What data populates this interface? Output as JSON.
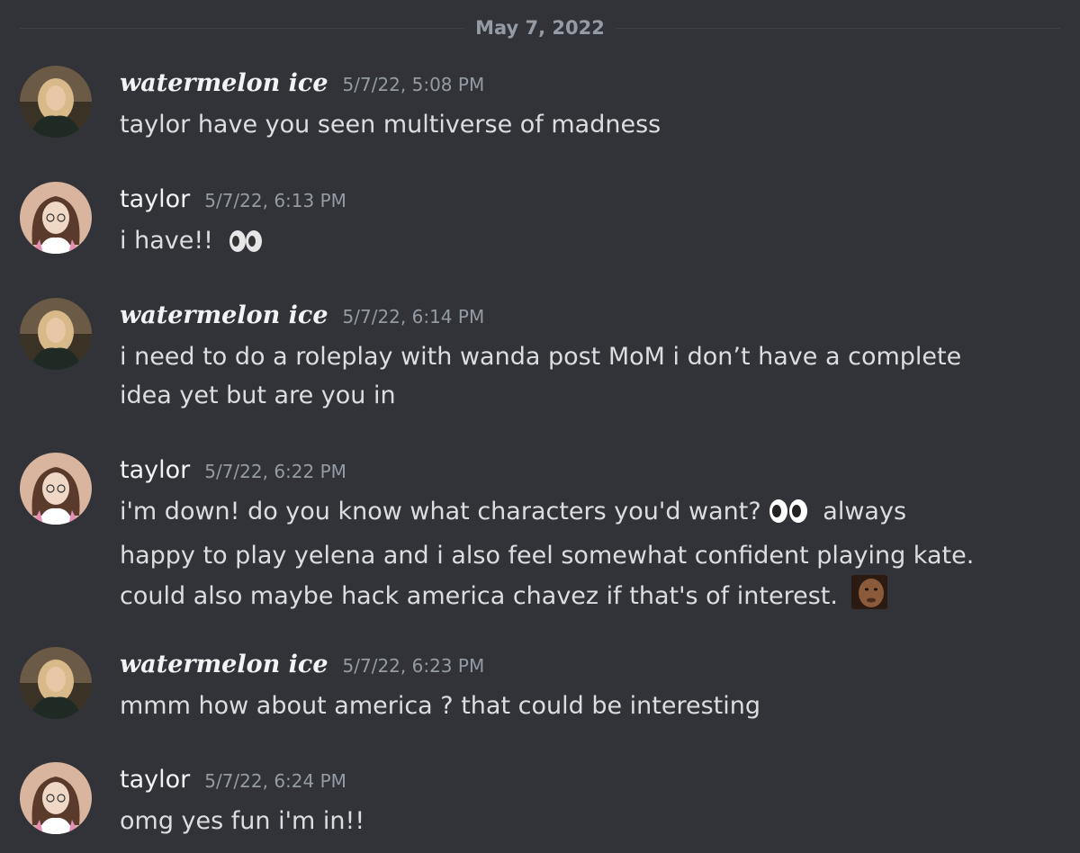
{
  "divider": {
    "date": "May 7, 2022"
  },
  "messages": [
    {
      "author": "watermelon ice",
      "timestamp": "5/7/22, 5:08 PM",
      "text": "taylor have you seen multiverse of madness"
    },
    {
      "author": "taylor",
      "timestamp": "5/7/22, 6:13 PM",
      "text": "i have!!",
      "emoji": "eyes-icon"
    },
    {
      "author": "watermelon ice",
      "timestamp": "5/7/22, 6:14 PM",
      "text": "i need to do a roleplay with wanda post MoM i don’t have a complete idea yet but are you in"
    },
    {
      "author": "taylor",
      "timestamp": "5/7/22, 6:22 PM",
      "text_part1": "i'm down! do you know what characters you'd want?",
      "text_part2": "always happy to play yelena and i also feel somewhat confident playing kate. could also maybe hack america chavez if that's of interest.",
      "emoji1": "eyes-icon",
      "emoji2": "reaction-face-emoji"
    },
    {
      "author": "watermelon ice",
      "timestamp": "5/7/22, 6:23 PM",
      "text": "mmm how about america ? that could be interesting"
    },
    {
      "author": "taylor",
      "timestamp": "5/7/22, 6:24 PM",
      "text": "omg yes fun i'm in!!"
    }
  ],
  "colors": {
    "background": "#313338",
    "text": "#dbdee1",
    "username": "#f2f3f5",
    "muted": "#949ba4"
  }
}
